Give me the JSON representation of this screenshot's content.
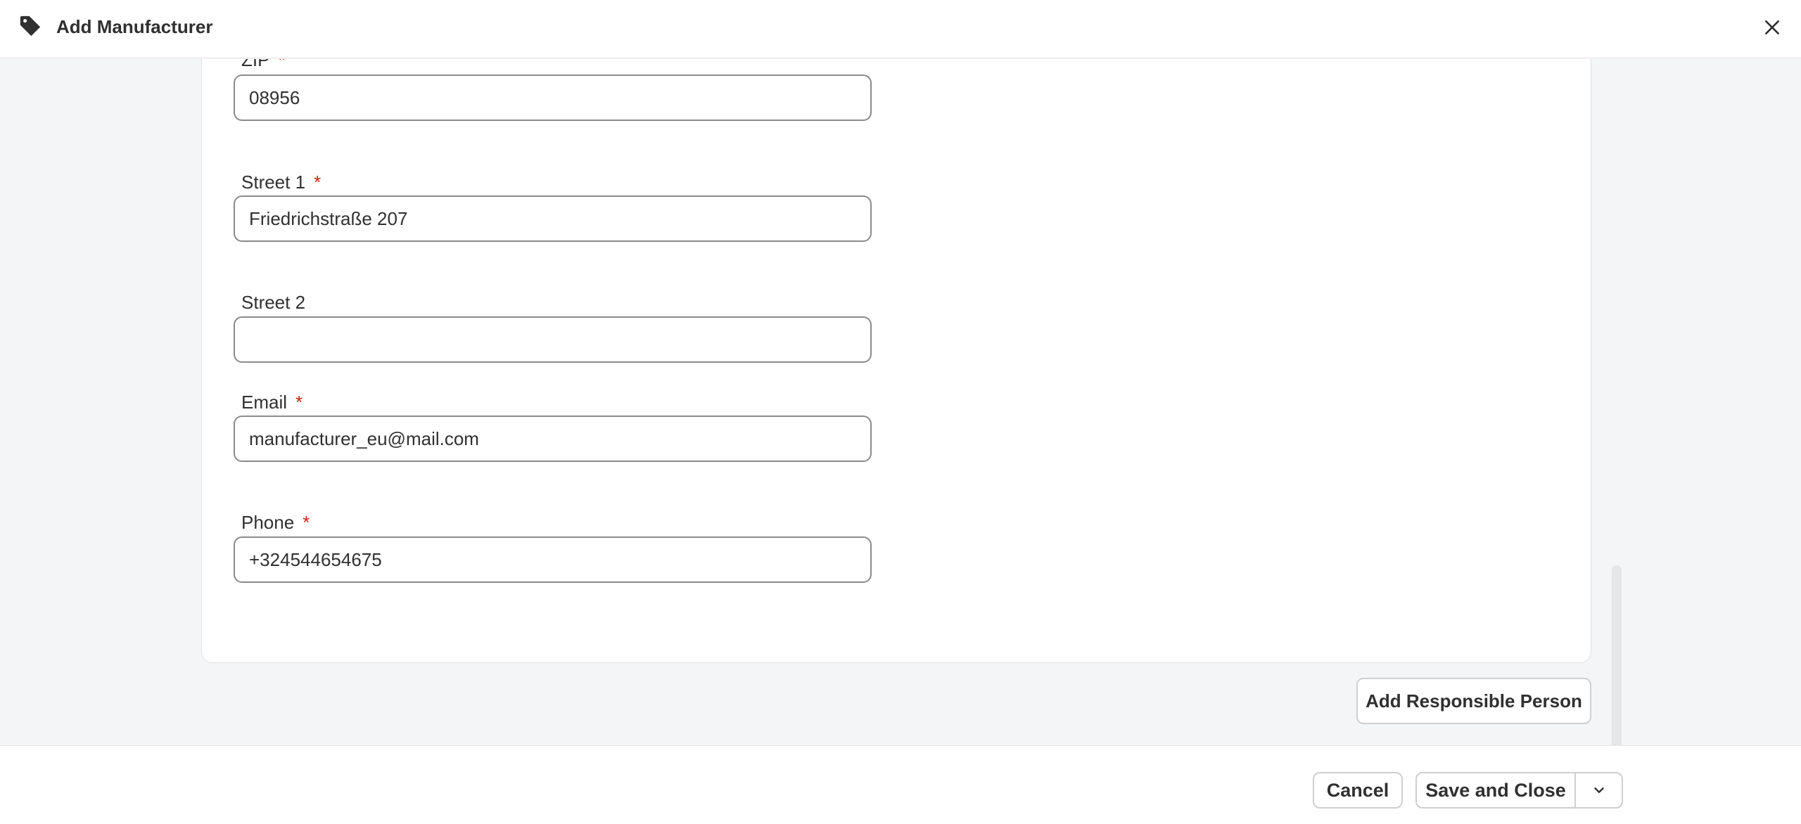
{
  "header": {
    "title": "Add Manufacturer",
    "icon": "tag-icon",
    "close_icon": "close-icon"
  },
  "form": {
    "zip": {
      "label": "ZIP",
      "required_mark": "*",
      "value": "08956"
    },
    "street1": {
      "label": "Street 1",
      "required_mark": "*",
      "value": "Friedrichstraße 207"
    },
    "street2": {
      "label": "Street 2",
      "value": ""
    },
    "email": {
      "label": "Email",
      "required_mark": "*",
      "value": "manufacturer_eu@mail.com"
    },
    "phone": {
      "label": "Phone",
      "required_mark": "*",
      "value": "+324544654675"
    }
  },
  "actions": {
    "add_responsible_person": "Add Responsible Person",
    "cancel": "Cancel",
    "save_and_close": "Save and Close",
    "more_icon": "chevron-down-icon"
  },
  "colors": {
    "required": "#c5280c",
    "background": "#f4f5f7",
    "border": "#8a8a8a"
  }
}
